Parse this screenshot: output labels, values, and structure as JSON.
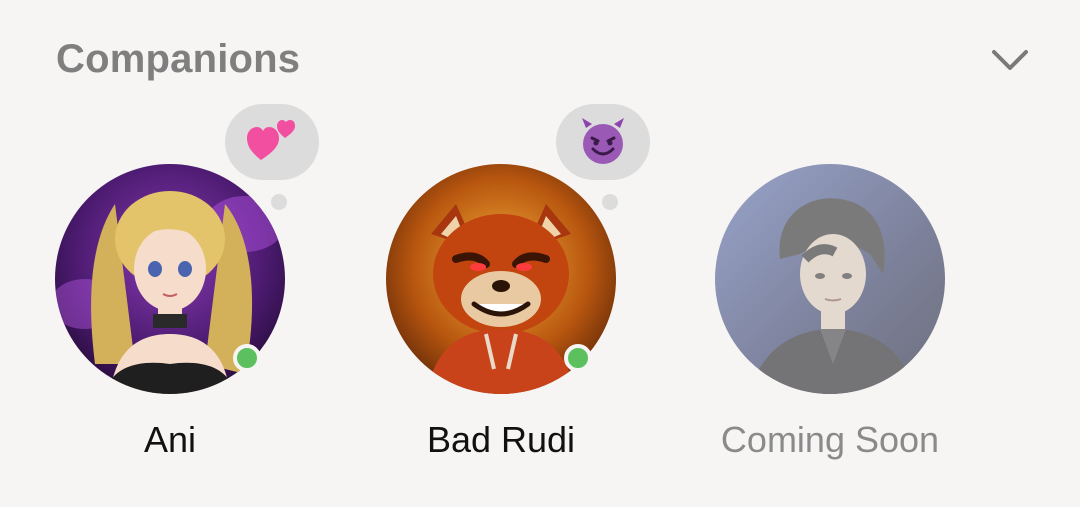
{
  "section": {
    "title": "Companions",
    "toggle_icon": "chevron-down-icon"
  },
  "companions": [
    {
      "name": "Ani",
      "status": "online",
      "mood_emoji": "💕",
      "mood_icon": "two-hearts-icon",
      "available": true
    },
    {
      "name": "Bad Rudi",
      "status": "online",
      "mood_emoji": "😈",
      "mood_icon": "smiling-devil-icon",
      "available": true
    },
    {
      "name": "Coming Soon",
      "available": false
    }
  ],
  "colors": {
    "background": "#f7f5f3",
    "title": "#7f7f7f",
    "online": "#5cc05e",
    "bubble": "#dcdcdc",
    "name": "#111111",
    "name_muted": "#8a8a8a"
  }
}
